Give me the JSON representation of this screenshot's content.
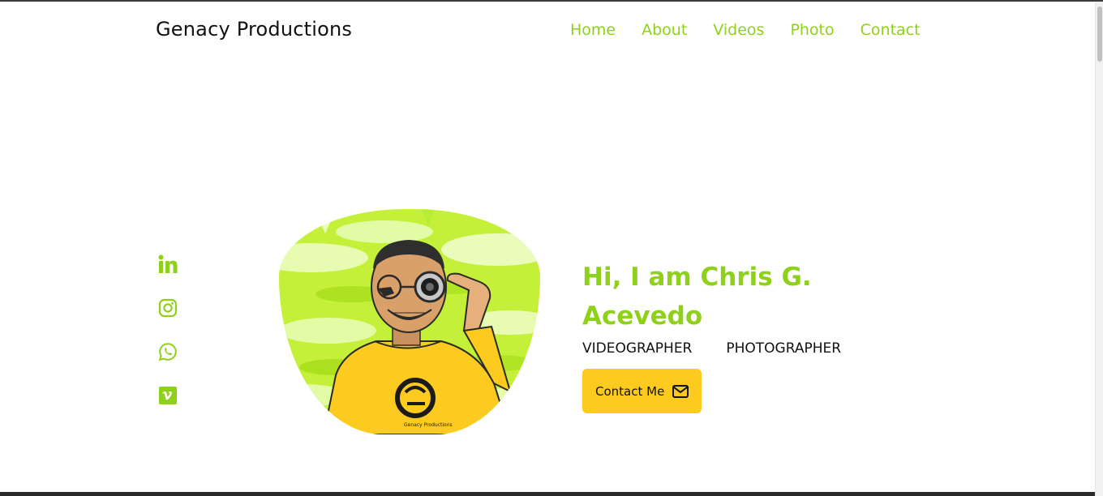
{
  "brand": {
    "name": "Genacy Productions"
  },
  "nav": {
    "items": [
      {
        "label": "Home"
      },
      {
        "label": "About"
      },
      {
        "label": "Videos"
      },
      {
        "label": "Photo"
      },
      {
        "label": "Contact"
      }
    ]
  },
  "social": {
    "icons": [
      "linkedin-icon",
      "instagram-icon",
      "whatsapp-icon",
      "vimeo-icon"
    ]
  },
  "hero": {
    "title": "Hi, I am Chris G. Acevedo",
    "roles": [
      "VIDEOGRAPHER",
      "PHOTOGRAPHER"
    ],
    "cta_label": "Contact Me",
    "cta_icon": "envelope-icon",
    "avatar_logo_text": "Genacy Productions"
  },
  "colors": {
    "accent": "#8fd11a",
    "button": "#fdcb1f",
    "text": "#111111"
  }
}
